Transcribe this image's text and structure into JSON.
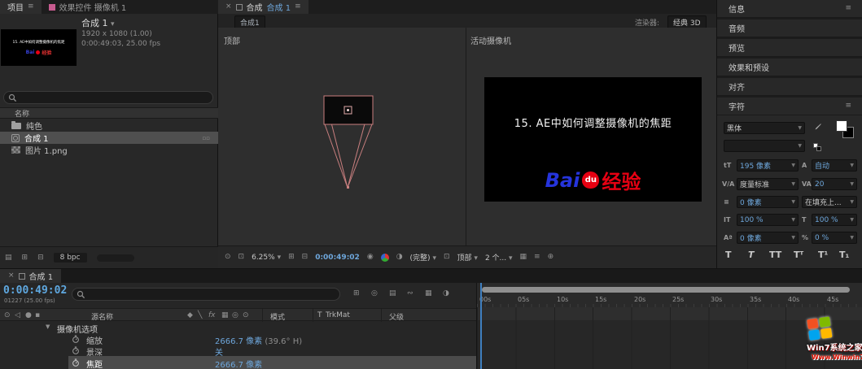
{
  "colors": {
    "accent_blue": "#6ea7dc",
    "time_blue": "#5fa8e0",
    "selection_gray": "#4d4d4d",
    "brand_blue": "#2534dc",
    "brand_red": "#e60012",
    "wireframe_pink": "#c97f7f"
  },
  "icons": {
    "menu": "≡",
    "close": "×",
    "caret": "▾",
    "caret_box": "▼",
    "twirl": "▼",
    "eye": "⊙",
    "audio": "◁",
    "solo": "●",
    "lock": "▪",
    "grid": "⊞",
    "mask": "⊟",
    "roi": "⊡",
    "half": "◑",
    "snapshot": "◉",
    "monitor": "⊡",
    "target": "⊕",
    "shy": "◆",
    "slash": "╲",
    "fx": "fx",
    "blend": "▦",
    "motion": "◎",
    "wave": "∾",
    "rows_icon": "▤",
    "badges": "▫▫"
  },
  "project": {
    "tabs": {
      "project": "项目",
      "effect_controls": "效果控件 摄像机 1"
    },
    "comp": {
      "name": "合成 1",
      "meta1": "1920 x 1080 (1.00)",
      "meta2": "0:00:49:03, 25.00 fps"
    },
    "list": {
      "header": "名称",
      "rows": [
        {
          "label": "纯色"
        },
        {
          "label": "合成 1"
        },
        {
          "label": "图片 1.png"
        }
      ]
    },
    "footer": {
      "bpc": "8 bpc"
    }
  },
  "viewer": {
    "tab": {
      "panel": "合成",
      "comp": "合成 1"
    },
    "view_tab": "合成1",
    "renderer": {
      "label": "渲染器:",
      "value": "经典 3D"
    },
    "viewports": {
      "left_label": "顶部",
      "right_label": "活动摄像机"
    },
    "frame": {
      "title": "15. AE中如何调整摄像机的焦距",
      "brand_bai": "Bai",
      "brand_du": "du",
      "brand_jingyan": "经验"
    },
    "toolbar": {
      "zoom": "6.25%",
      "time": "0:00:49:02",
      "quality": "(完整)",
      "view": "顶部",
      "views_count": "2 个..."
    }
  },
  "sidebar": {
    "panels": {
      "info": "信息",
      "audio": "音频",
      "preview": "预览",
      "effects_presets": "效果和预设",
      "align": "对齐",
      "character": "字符"
    },
    "character": {
      "font": "黑体",
      "style": "",
      "size_icon": "tT",
      "size": "195 像素",
      "leading_icon": "A",
      "leading": "自动",
      "kerning_icon": "V/A",
      "kerning": "度量标准",
      "tracking_icon": "VA",
      "tracking": "20",
      "stroke_width_icon": "≡",
      "stroke_width": "0 像素",
      "stroke_style": "在填充上...",
      "vscale_icon": "IT",
      "vscale": "100 %",
      "hscale_icon": "T",
      "hscale": "100 %",
      "baseline_icon": "Aª",
      "baseline": "0 像素",
      "tsume_icon": "%",
      "tsume": "0 %",
      "toggles": [
        "T",
        "T",
        "TT",
        "Tᵀ",
        "T¹",
        "T₁"
      ]
    }
  },
  "timeline": {
    "tab": "合成 1",
    "time": "0:00:49:02",
    "frames": "01227 (25.00 fps)",
    "columns": {
      "t": "T",
      "source": "源名称",
      "mode": "模式",
      "trkmat": "TrkMat",
      "parent": "父级"
    },
    "group": "摄像机选项",
    "props": {
      "zoom": {
        "label": "缩放",
        "value": "2666.7 像素",
        "suffix": "(39.6° H)"
      },
      "dof": {
        "label": "景深",
        "value": "关"
      },
      "focus": {
        "label": "焦距",
        "value": "2666.7 像素"
      }
    },
    "ruler": [
      "00s",
      "05s",
      "10s",
      "15s",
      "20s",
      "25s",
      "30s",
      "35s",
      "40s",
      "45s"
    ]
  },
  "watermark": {
    "title": "Win7系统之家",
    "url": "Www.Winwin7.com"
  }
}
